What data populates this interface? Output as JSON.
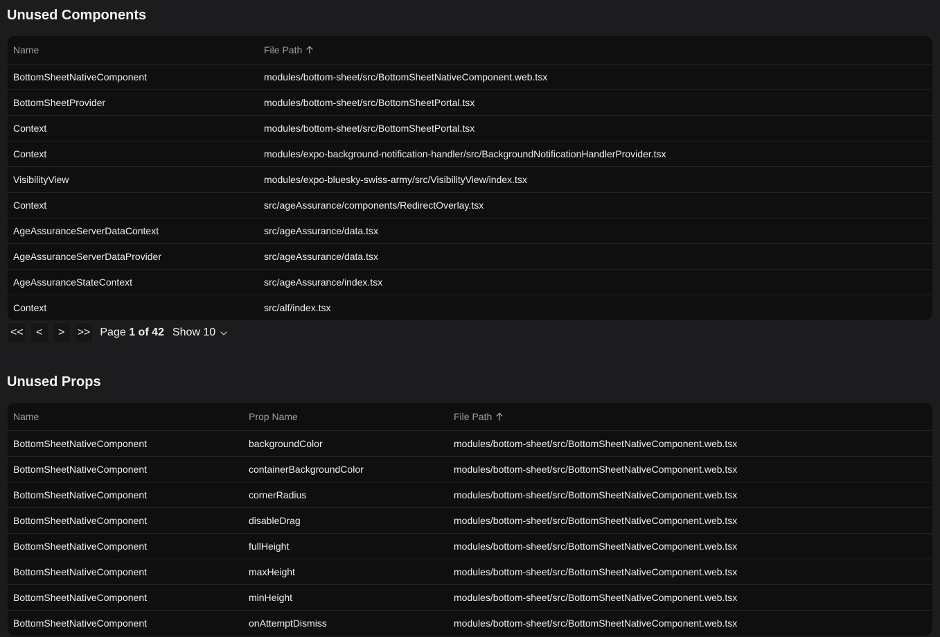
{
  "unused_components": {
    "title": "Unused Components",
    "columns": {
      "name": "Name",
      "file_path": "File Path"
    },
    "rows": [
      {
        "name": "BottomSheetNativeComponent",
        "file_path": "modules/bottom-sheet/src/BottomSheetNativeComponent.web.tsx"
      },
      {
        "name": "BottomSheetProvider",
        "file_path": "modules/bottom-sheet/src/BottomSheetPortal.tsx"
      },
      {
        "name": "Context",
        "file_path": "modules/bottom-sheet/src/BottomSheetPortal.tsx"
      },
      {
        "name": "Context",
        "file_path": "modules/expo-background-notification-handler/src/BackgroundNotificationHandlerProvider.tsx"
      },
      {
        "name": "VisibilityView",
        "file_path": "modules/expo-bluesky-swiss-army/src/VisibilityView/index.tsx"
      },
      {
        "name": "Context",
        "file_path": "src/ageAssurance/components/RedirectOverlay.tsx"
      },
      {
        "name": "AgeAssuranceServerDataContext",
        "file_path": "src/ageAssurance/data.tsx"
      },
      {
        "name": "AgeAssuranceServerDataProvider",
        "file_path": "src/ageAssurance/data.tsx"
      },
      {
        "name": "AgeAssuranceStateContext",
        "file_path": "src/ageAssurance/index.tsx"
      },
      {
        "name": "Context",
        "file_path": "src/alf/index.tsx"
      }
    ],
    "pagination": {
      "first": "<<",
      "prev": "<",
      "next": ">",
      "last": ">>",
      "page_prefix": "Page",
      "page_current": "1 of 42",
      "show_label": "Show 10"
    }
  },
  "unused_props": {
    "title": "Unused Props",
    "columns": {
      "name": "Name",
      "prop_name": "Prop Name",
      "file_path": "File Path"
    },
    "rows": [
      {
        "name": "BottomSheetNativeComponent",
        "prop": "backgroundColor",
        "file_path": "modules/bottom-sheet/src/BottomSheetNativeComponent.web.tsx"
      },
      {
        "name": "BottomSheetNativeComponent",
        "prop": "containerBackgroundColor",
        "file_path": "modules/bottom-sheet/src/BottomSheetNativeComponent.web.tsx"
      },
      {
        "name": "BottomSheetNativeComponent",
        "prop": "cornerRadius",
        "file_path": "modules/bottom-sheet/src/BottomSheetNativeComponent.web.tsx"
      },
      {
        "name": "BottomSheetNativeComponent",
        "prop": "disableDrag",
        "file_path": "modules/bottom-sheet/src/BottomSheetNativeComponent.web.tsx"
      },
      {
        "name": "BottomSheetNativeComponent",
        "prop": "fullHeight",
        "file_path": "modules/bottom-sheet/src/BottomSheetNativeComponent.web.tsx"
      },
      {
        "name": "BottomSheetNativeComponent",
        "prop": "maxHeight",
        "file_path": "modules/bottom-sheet/src/BottomSheetNativeComponent.web.tsx"
      },
      {
        "name": "BottomSheetNativeComponent",
        "prop": "minHeight",
        "file_path": "modules/bottom-sheet/src/BottomSheetNativeComponent.web.tsx"
      },
      {
        "name": "BottomSheetNativeComponent",
        "prop": "onAttemptDismiss",
        "file_path": "modules/bottom-sheet/src/BottomSheetNativeComponent.web.tsx"
      }
    ]
  },
  "icons": {
    "sort": "arrow-up-icon",
    "dropdown": "chevron-down-icon"
  },
  "colors": {
    "background": "#1c1c1e",
    "table_background": "#0f0f10",
    "header_text": "#9e9ea3",
    "body_text": "#f0f0f0"
  }
}
